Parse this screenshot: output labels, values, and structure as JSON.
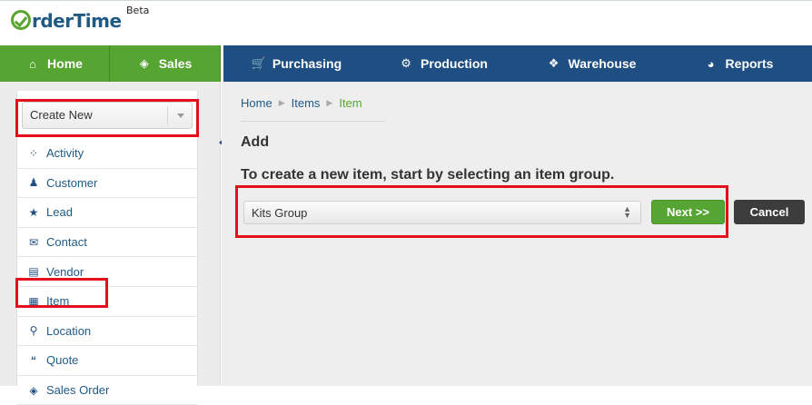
{
  "app": {
    "logo_text": "rderTime",
    "beta_label": "Beta"
  },
  "nav": {
    "items": [
      {
        "label": "Home",
        "icon": "home-icon"
      },
      {
        "label": "Sales",
        "icon": "tag-icon"
      },
      {
        "label": "Purchasing",
        "icon": "cart-icon"
      },
      {
        "label": "Production",
        "icon": "gears-icon"
      },
      {
        "label": "Warehouse",
        "icon": "box-icon"
      },
      {
        "label": "Reports",
        "icon": "pie-chart-icon"
      }
    ]
  },
  "sidebar": {
    "create_new": "Create New",
    "items": [
      {
        "label": "Activity",
        "icon": "spinner-icon"
      },
      {
        "label": "Customer",
        "icon": "user-icon"
      },
      {
        "label": "Lead",
        "icon": "star-icon"
      },
      {
        "label": "Contact",
        "icon": "envelope-icon"
      },
      {
        "label": "Vendor",
        "icon": "archive-icon"
      },
      {
        "label": "Item",
        "icon": "grid-icon"
      },
      {
        "label": "Location",
        "icon": "map-marker-icon"
      },
      {
        "label": "Quote",
        "icon": "quote-icon"
      },
      {
        "label": "Sales Order",
        "icon": "tag-icon"
      }
    ]
  },
  "main": {
    "breadcrumb": [
      "Home",
      "Items",
      "Item"
    ],
    "title": "Add",
    "instruction": "To create a new item, start by selecting an item group.",
    "item_group": "Kits Group",
    "next_label": "Next >>",
    "cancel_label": "Cancel"
  },
  "colors": {
    "green": "#56a532",
    "blue": "#1f4f82",
    "highlight": "#e3101c"
  }
}
